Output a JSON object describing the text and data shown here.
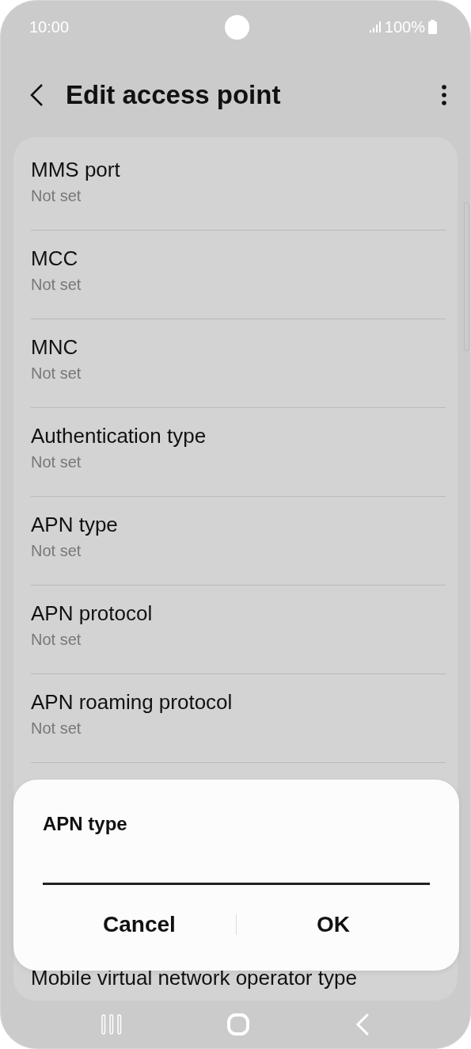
{
  "status_bar": {
    "time": "10:00",
    "battery": "100%"
  },
  "header": {
    "title": "Edit access point"
  },
  "settings": [
    {
      "title": "MMS port",
      "value": "Not set"
    },
    {
      "title": "MCC",
      "value": "Not set"
    },
    {
      "title": "MNC",
      "value": "Not set"
    },
    {
      "title": "Authentication type",
      "value": "Not set"
    },
    {
      "title": "APN type",
      "value": "Not set"
    },
    {
      "title": "APN protocol",
      "value": "Not set"
    },
    {
      "title": "APN roaming protocol",
      "value": "Not set"
    }
  ],
  "partial_row": {
    "title": "Mobile virtual network operator type"
  },
  "dialog": {
    "title": "APN type",
    "buttons": [
      "Cancel",
      "OK"
    ]
  }
}
